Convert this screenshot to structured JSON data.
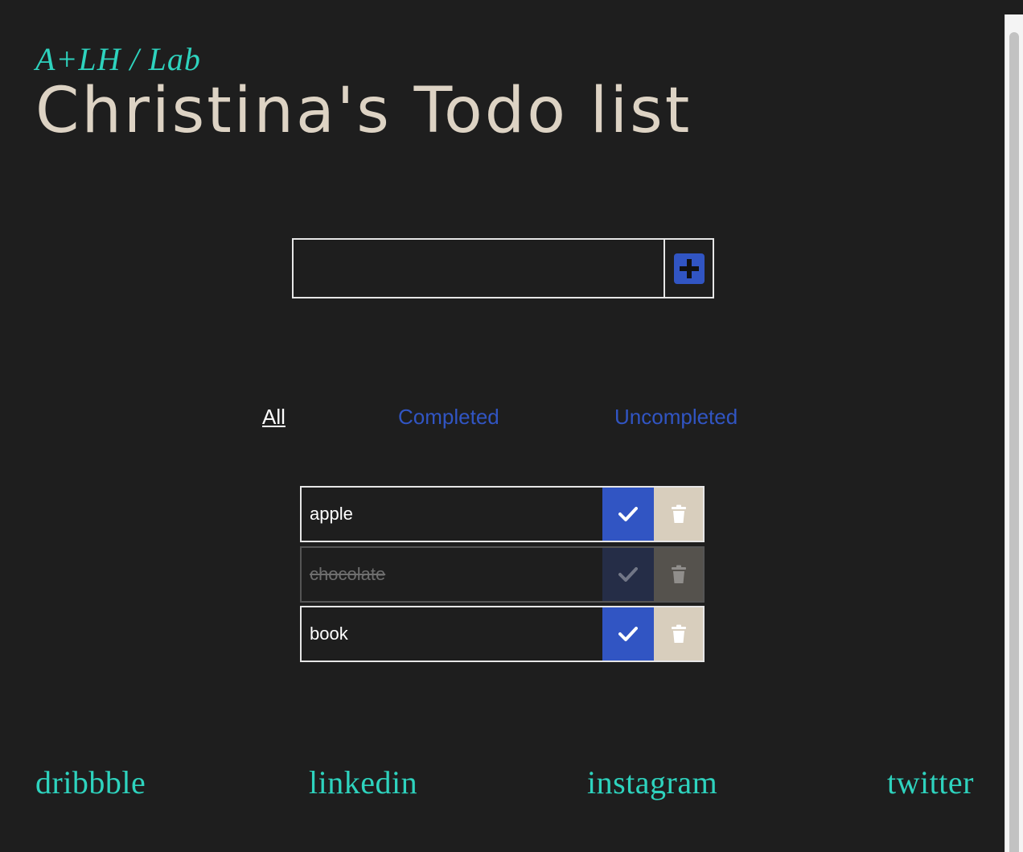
{
  "header": {
    "lab": "A+LH / Lab",
    "title": "Christina's Todo list"
  },
  "add_form": {
    "input_value": "",
    "add_icon": "plus-square-icon"
  },
  "filters": [
    {
      "label": "All",
      "active": true
    },
    {
      "label": "Completed",
      "active": false
    },
    {
      "label": "Uncompleted",
      "active": false
    }
  ],
  "todos": [
    {
      "text": "apple",
      "completed": false
    },
    {
      "text": "chocolate",
      "completed": true
    },
    {
      "text": "book",
      "completed": false
    }
  ],
  "footer": {
    "links": [
      "dribbble",
      "linkedin",
      "instagram",
      "twitter"
    ]
  },
  "colors": {
    "background": "#1e1e1e",
    "accent_teal": "#2ed3be",
    "accent_blue": "#3155c3",
    "title": "#ddd3c4",
    "trash_bg": "#d8cebd"
  }
}
